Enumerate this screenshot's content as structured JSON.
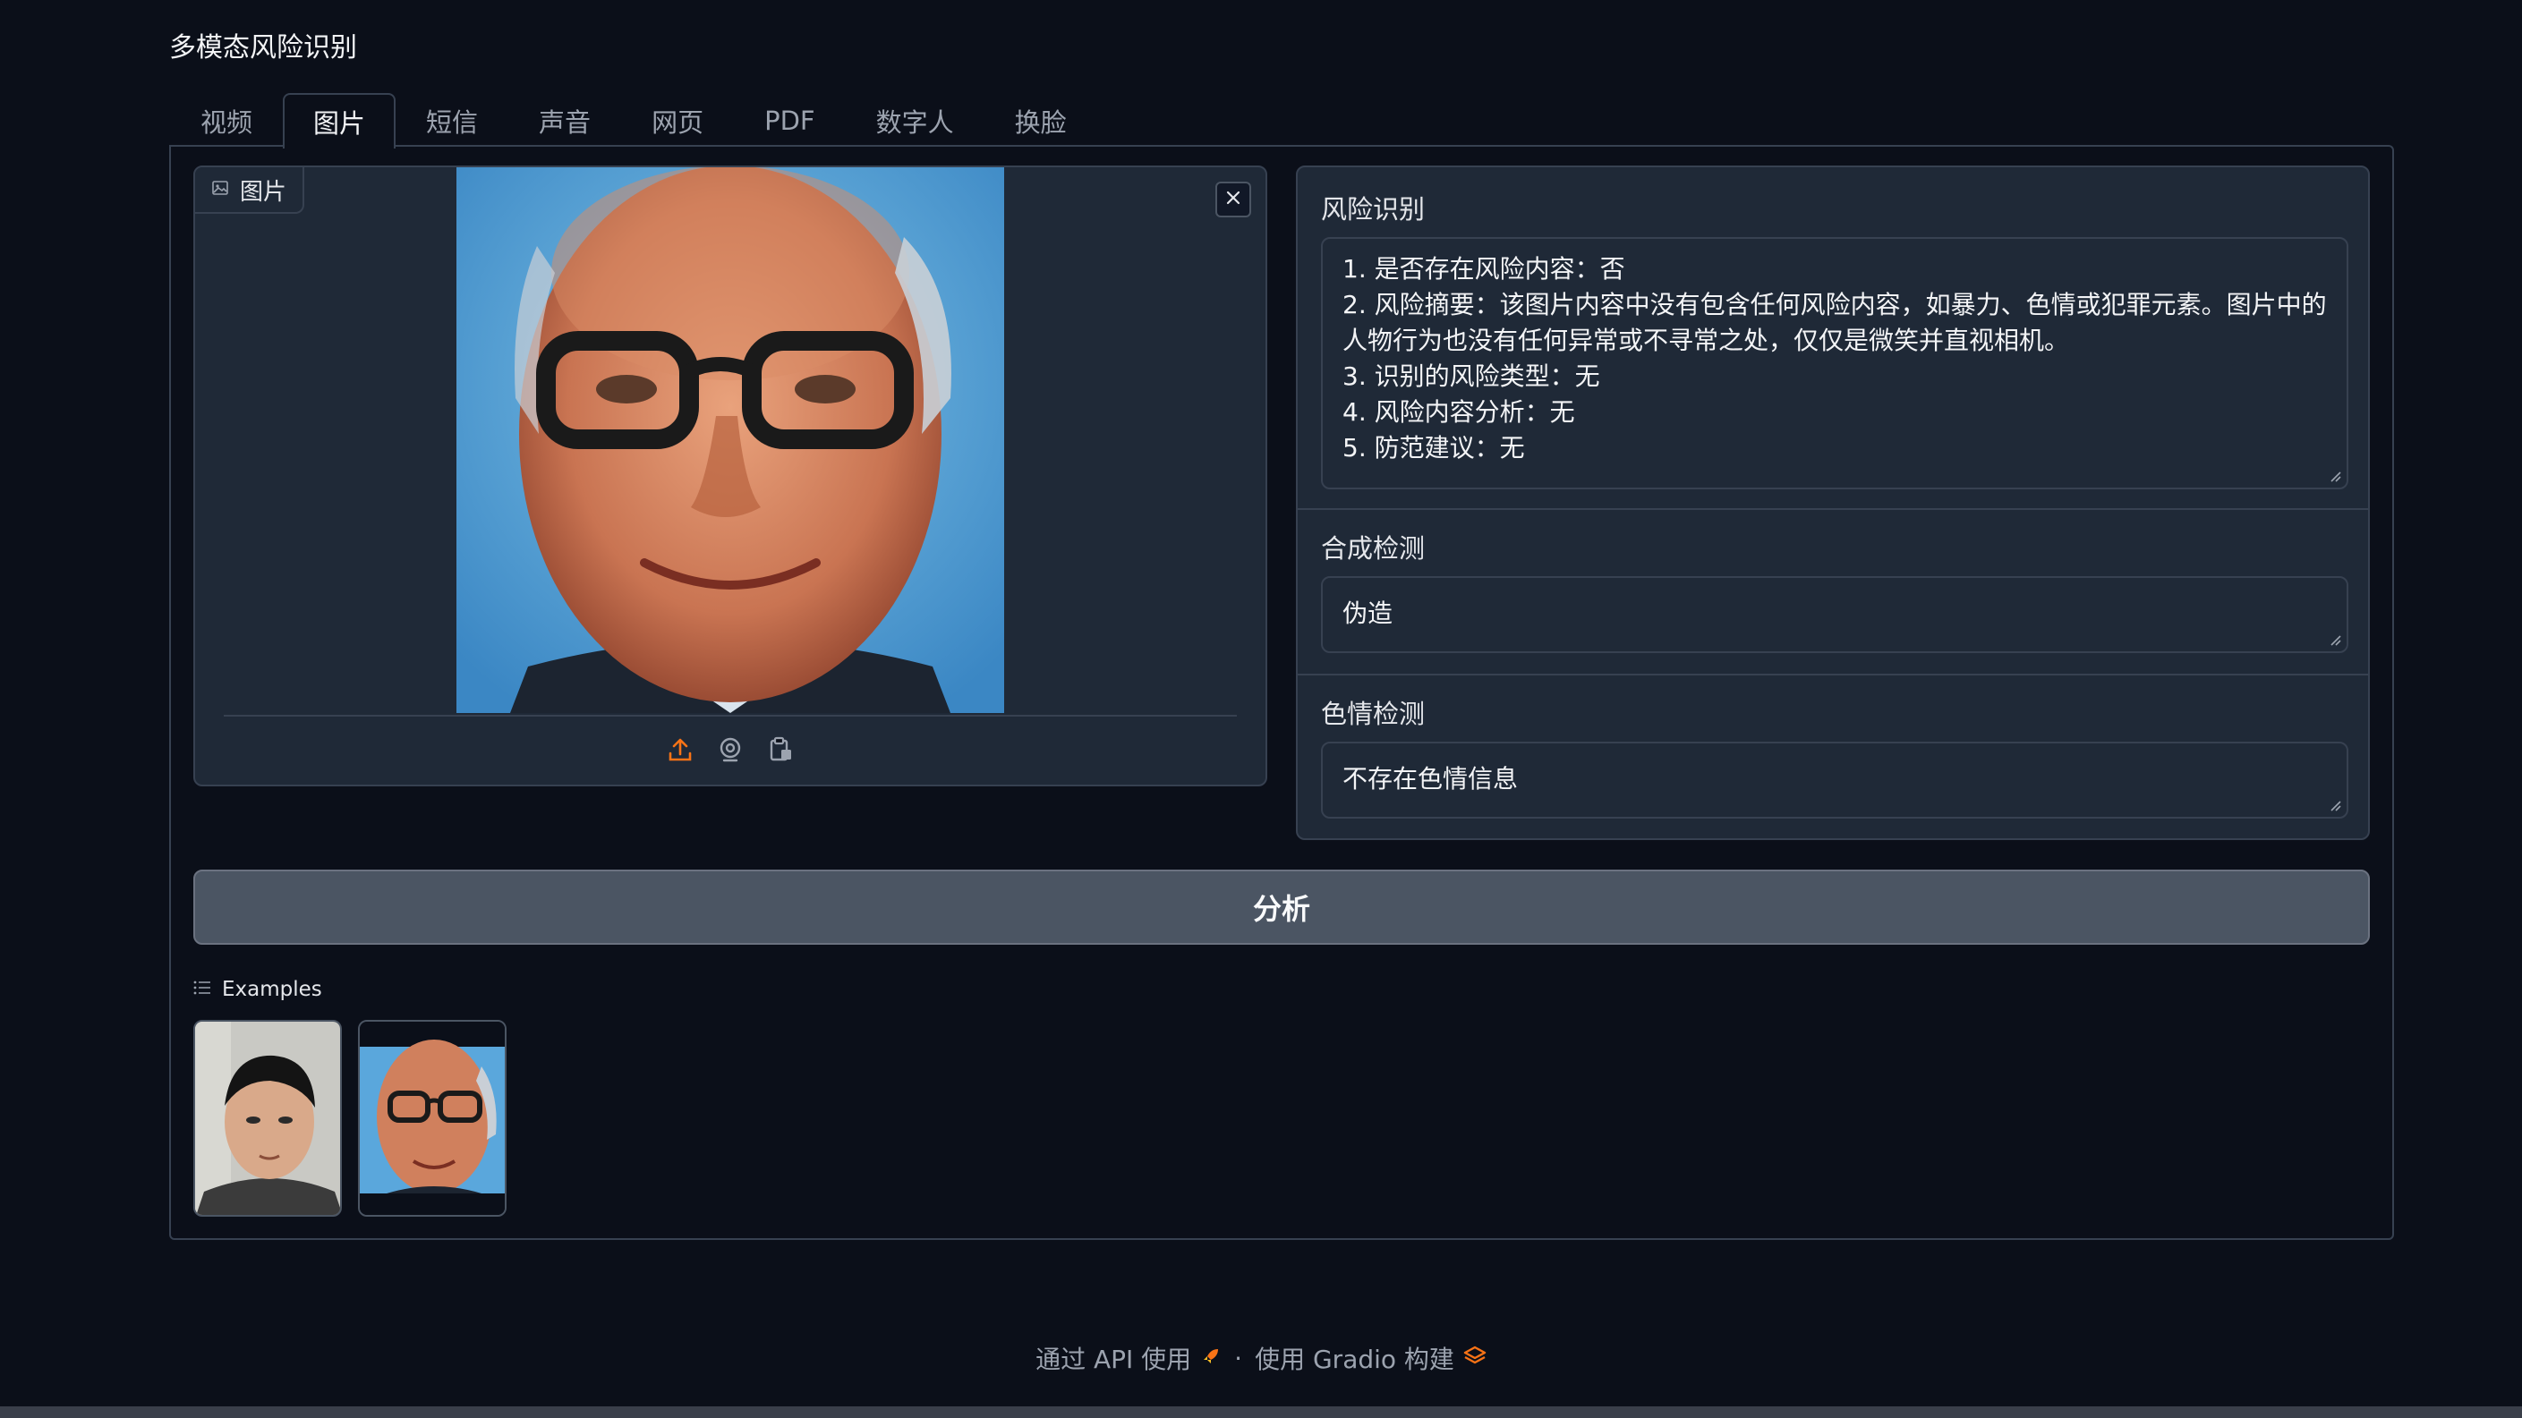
{
  "app": {
    "title": "多模态风险识别"
  },
  "tabs": [
    {
      "label": "视频",
      "active": false
    },
    {
      "label": "图片",
      "active": true
    },
    {
      "label": "短信",
      "active": false
    },
    {
      "label": "声音",
      "active": false
    },
    {
      "label": "网页",
      "active": false
    },
    {
      "label": "PDF",
      "active": false
    },
    {
      "label": "数字人",
      "active": false
    },
    {
      "label": "换脸",
      "active": false
    }
  ],
  "image_input": {
    "label": "图片",
    "icons": [
      "image-icon",
      "close-icon",
      "upload-icon",
      "webcam-icon",
      "clipboard-icon"
    ]
  },
  "outputs": {
    "risk": {
      "label": "风险识别",
      "lines": [
        "1. 是否存在风险内容：否",
        "2. 风险摘要：该图片内容中没有包含任何风险内容，如暴力、色情或犯罪元素。图片中的人物行为也没有任何异常或不寻常之处，仅仅是微笑并直视相机。",
        "3. 识别的风险类型：无",
        "4. 风险内容分析：无",
        "5. 防范建议：无"
      ]
    },
    "synthesis": {
      "label": "合成检测",
      "value": "伪造"
    },
    "porn": {
      "label": "色情检测",
      "value": "不存在色情信息"
    }
  },
  "actions": {
    "analyze_label": "分析"
  },
  "examples": {
    "label": "Examples"
  },
  "footer": {
    "api_label": "通过 API 使用",
    "separator": "·",
    "built_label": "使用 Gradio 构建"
  },
  "colors": {
    "background": "#0b0f19",
    "panel": "#1f2937",
    "border": "#374151",
    "button": "#4b5563",
    "accent_orange": "#f97316"
  }
}
